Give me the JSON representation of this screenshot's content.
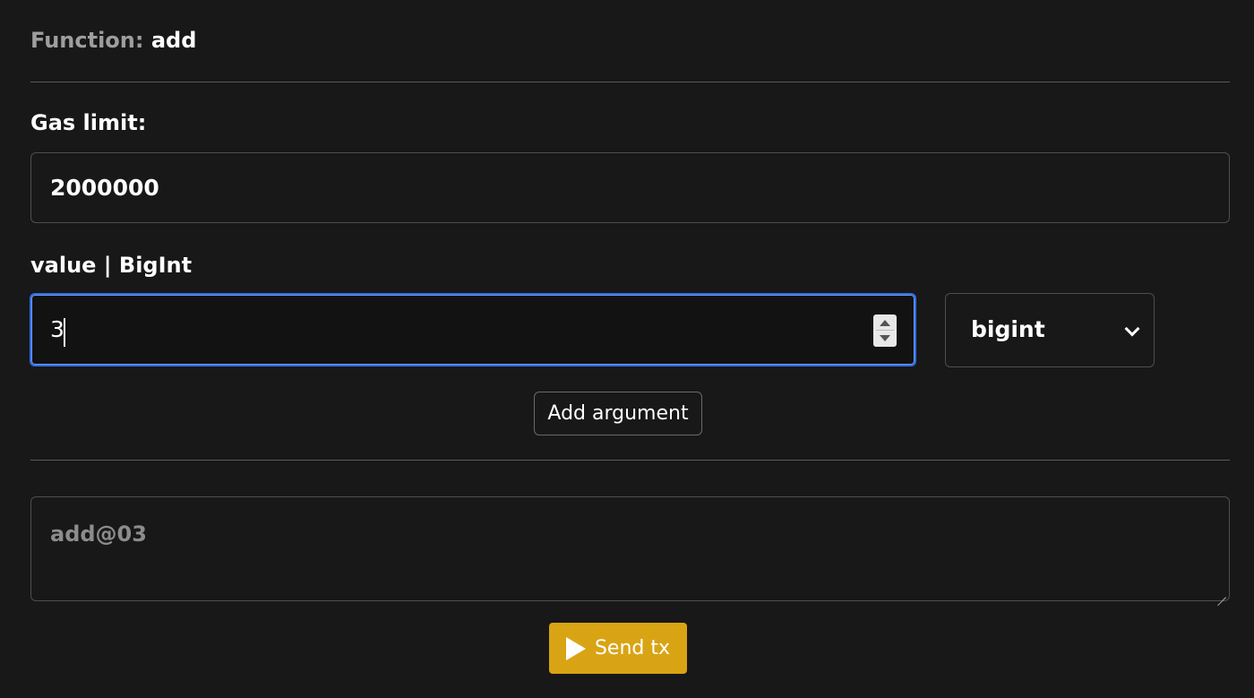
{
  "header": {
    "function_label": "Function:",
    "function_name": "add"
  },
  "gas": {
    "label": "Gas limit:",
    "value": "2000000"
  },
  "argument": {
    "label": "value | BigInt",
    "value": "3",
    "type_selected": "bigint"
  },
  "actions": {
    "add_argument_label": "Add argument",
    "send_label": "Send tx"
  },
  "tx_data": {
    "placeholder": "add@03"
  },
  "colors": {
    "background": "#181818",
    "accent": "#d9a414",
    "focus": "#2f6ee8"
  },
  "icons": {
    "send": "play-icon",
    "select": "chevron-down-icon",
    "number": "spinner-icon"
  }
}
